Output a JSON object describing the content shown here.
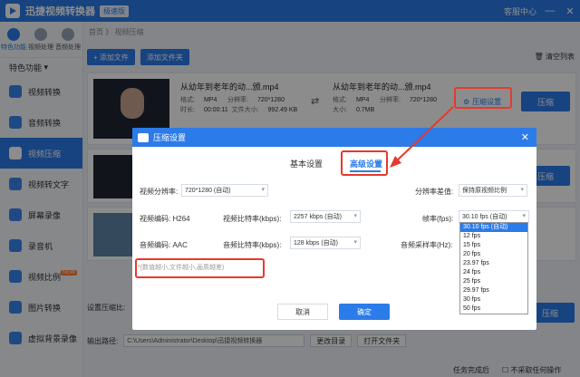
{
  "app": {
    "title": "迅捷视频转换器",
    "edition": "极速版",
    "service": "客服中心",
    "window_buttons": [
      "—",
      "✕"
    ]
  },
  "rail": {
    "top": [
      {
        "label": "特色功能",
        "icon": "star-icon"
      },
      {
        "label": "视频处理",
        "icon": "video-process-icon"
      },
      {
        "label": "音频处理",
        "icon": "audio-process-icon"
      }
    ],
    "section": "特色功能",
    "items": [
      {
        "label": "视频转换",
        "icon": "video-convert-icon"
      },
      {
        "label": "音频转换",
        "icon": "audio-convert-icon"
      },
      {
        "label": "视频压缩",
        "icon": "video-compress-icon"
      },
      {
        "label": "视频转文字",
        "icon": "video-to-text-icon"
      },
      {
        "label": "屏幕录像",
        "icon": "screen-record-icon"
      },
      {
        "label": "录音机",
        "icon": "recorder-icon"
      },
      {
        "label": "视频比例",
        "icon": "video-ratio-icon",
        "badge": "NEW"
      },
      {
        "label": "图片转换",
        "icon": "image-convert-icon"
      },
      {
        "label": "虚拟背景录像",
        "icon": "virtual-bg-icon"
      }
    ]
  },
  "main": {
    "breadcrumb": "首页 》 视频压缩",
    "add_file": "+ 添加文件",
    "add_folder": "添加文件夹",
    "clear_list": "清空列表",
    "file": {
      "name_left": "从幼年到老年的动...颁.mp4",
      "name_right": "从幼年到老年的动...颁.mp4",
      "format_label": "格式:",
      "format": "MP4",
      "resolution_label": "分辨率:",
      "resolution": "720*1280",
      "duration_label": "时长:",
      "duration": "00:00:11",
      "size_label": "文件大小:",
      "size": "992.49 KB",
      "out_size_label": "大小:",
      "out_size": "0.7MB",
      "settings_link": "压缩设置",
      "compress_btn": "压缩"
    },
    "bottom": {
      "settings_label": "设置压缩比:",
      "output_label": "输出路径:",
      "output_path": "C:\\Users\\Administrator\\Desktop\\迅捷视频转换器",
      "change_dir": "更改目录",
      "open_folder": "打开文件夹",
      "compress_all": "压缩"
    },
    "status": {
      "after_done": "任务完成后",
      "no_action": "不采取任何操作"
    }
  },
  "dialog": {
    "title": "压缩设置",
    "tab_basic": "基本设置",
    "tab_advanced": "高级设置",
    "video_res_label": "视频分辨率:",
    "video_res": "720*1280 (自动)",
    "res_diff_label": "分辨率差值:",
    "res_diff": "保持原视频比例",
    "video_codec_label": "视频编码:",
    "video_codec": "H264",
    "video_bitrate_label": "视频比特率(kbps):",
    "video_bitrate": "2257 kbps (自动)",
    "fps_label": "帧率(fps):",
    "fps": "30.10 fps (自动)",
    "audio_codec_label": "音频编码:",
    "audio_codec": "AAC",
    "audio_bitrate_label": "音频比特率(kbps):",
    "audio_bitrate": "128 kbps (自动)",
    "sample_rate_label": "音频采样率(Hz):",
    "hint": "*(数值越小,文件越小,画质越差)",
    "cancel": "取消",
    "ok": "确定",
    "fps_options": [
      "30.10 fps (自动)",
      "12 fps",
      "15 fps",
      "20 fps",
      "23.97 fps",
      "24 fps",
      "25 fps",
      "29.97 fps",
      "30 fps",
      "50 fps"
    ]
  },
  "colors": {
    "accent": "#2b7be9",
    "annotation": "#e53a2c"
  }
}
